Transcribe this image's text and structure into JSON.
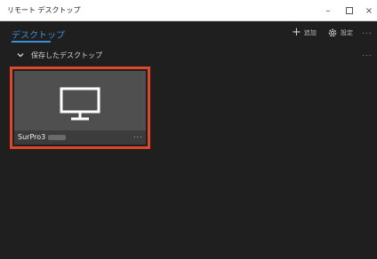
{
  "window": {
    "title": "リモート デスクトップ",
    "controls": {
      "minimize": "–",
      "close": "×"
    }
  },
  "nav": {
    "title": "デスクトップ",
    "add_icon": "+",
    "add_label": "追加",
    "settings_label": "設定",
    "more": "..."
  },
  "section": {
    "title": "保存したデスクトップ",
    "more": "..."
  },
  "tile": {
    "name": "SurPro3",
    "more": "...",
    "selected": true,
    "icon": "monitor-icon"
  },
  "colors": {
    "accent": "#3b8fd4",
    "selection": "#e0462a",
    "background": "#1f1f1f",
    "tile": "#4f4f4f"
  }
}
